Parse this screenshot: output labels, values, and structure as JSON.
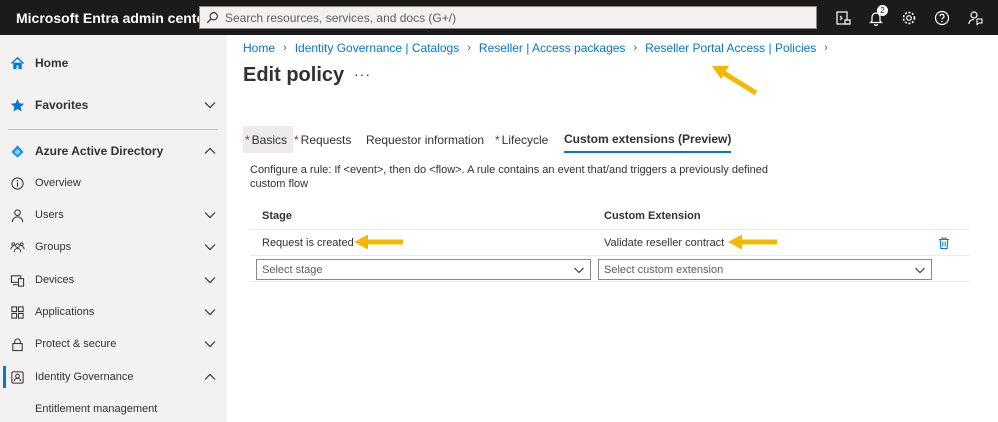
{
  "topbar": {
    "brand": "Microsoft Entra admin center",
    "search_placeholder": "Search resources, services, and docs (G+/)",
    "notification_count": "2"
  },
  "sidebar": {
    "items": [
      {
        "label": "Home",
        "icon": "home-icon"
      },
      {
        "label": "Favorites",
        "icon": "star-icon"
      },
      {
        "label": "Azure Active Directory",
        "icon": "azure-ad-icon"
      },
      {
        "label": "Overview",
        "icon": "info-icon"
      },
      {
        "label": "Users",
        "icon": "user-icon"
      },
      {
        "label": "Groups",
        "icon": "groups-icon"
      },
      {
        "label": "Devices",
        "icon": "devices-icon"
      },
      {
        "label": "Applications",
        "icon": "applications-icon"
      },
      {
        "label": "Protect & secure",
        "icon": "lock-icon"
      },
      {
        "label": "Identity Governance",
        "icon": "identity-governance-icon"
      },
      {
        "label": "Entitlement management"
      }
    ]
  },
  "breadcrumb": {
    "items": [
      "Home",
      "Identity Governance | Catalogs",
      "Reseller | Access packages",
      "Reseller Portal Access | Policies"
    ]
  },
  "page": {
    "title": "Edit policy",
    "more": "···"
  },
  "tabs": {
    "basics": "Basics",
    "requests": "Requests",
    "requestor_information": "Requestor information",
    "lifecycle": "Lifecycle",
    "custom_extensions": "Custom extensions (Preview)",
    "required_marker": "*"
  },
  "description": "Configure a rule: If <event>, then do <flow>. A rule contains an event that/and triggers a previously defined custom flow",
  "table": {
    "headers": {
      "stage": "Stage",
      "custom_extension": "Custom Extension"
    },
    "rows": [
      {
        "stage": "Request is created",
        "custom_extension": "Validate reseller contract"
      }
    ],
    "new_row": {
      "stage_placeholder": "Select stage",
      "extension_placeholder": "Select custom extension"
    }
  },
  "colors": {
    "accent": "#0078d4",
    "topbar": "#1b1b1b",
    "sidebar": "#f3f2f1",
    "required": "#a4262c",
    "annotation_arrow": "#f5b800"
  }
}
